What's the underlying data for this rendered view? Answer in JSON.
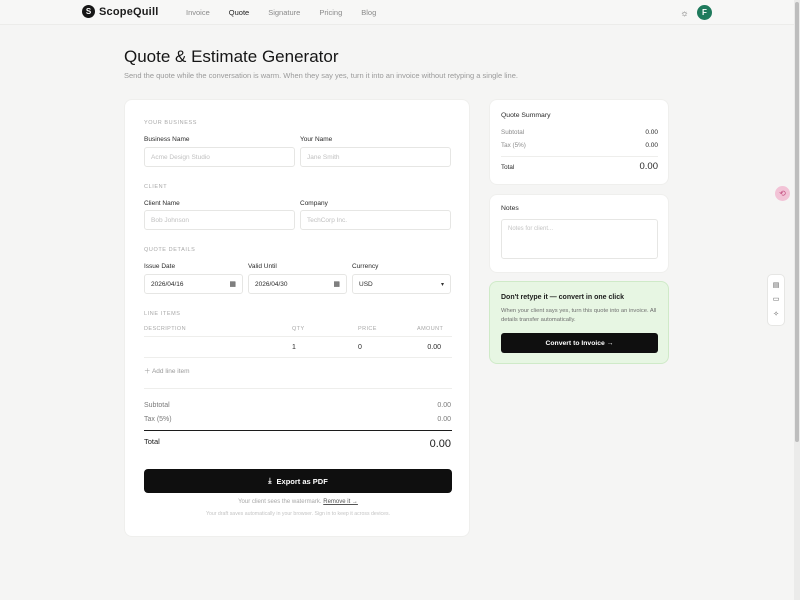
{
  "nav": {
    "brand": "ScopeQuill",
    "links": [
      "Invoice",
      "Quote",
      "Signature",
      "Pricing",
      "Blog"
    ],
    "active": "Quote",
    "avatar_initial": "F"
  },
  "header": {
    "title": "Quote & Estimate Generator",
    "subtitle": "Send the quote while the conversation is warm. When they say yes, turn it into an invoice without retyping a single line."
  },
  "form": {
    "your_business": {
      "section_label": "YOUR BUSINESS",
      "business_name_label": "Business Name",
      "business_name_placeholder": "Acme Design Studio",
      "your_name_label": "Your Name",
      "your_name_placeholder": "Jane Smith"
    },
    "client": {
      "section_label": "CLIENT",
      "client_name_label": "Client Name",
      "client_name_placeholder": "Bob Johnson",
      "company_label": "Company",
      "company_placeholder": "TechCorp Inc."
    },
    "quote_details": {
      "section_label": "QUOTE DETAILS",
      "issue_date_label": "Issue Date",
      "issue_date_value": "2026/04/16",
      "valid_until_label": "Valid Until",
      "valid_until_value": "2026/04/30",
      "currency_label": "Currency",
      "currency_value": "USD"
    },
    "line_items": {
      "section_label": "LINE ITEMS",
      "columns": [
        "DESCRIPTION",
        "QTY",
        "PRICE",
        "AMOUNT"
      ],
      "rows": [
        {
          "description": "",
          "qty": "1",
          "price": "0",
          "amount": "0.00"
        }
      ],
      "add_label": "Add line item"
    },
    "totals": {
      "subtotal_label": "Subtotal",
      "subtotal_value": "0.00",
      "tax_label": "Tax (5%)",
      "tax_value": "0.00",
      "total_label": "Total",
      "total_value": "0.00"
    },
    "export_label": "Export as PDF",
    "watermark_text": "Your client sees the watermark.",
    "watermark_link": "Remove it →",
    "draft_note": "Your draft saves automatically in your browser. Sign in to keep it across devices."
  },
  "summary": {
    "title": "Quote Summary",
    "subtotal_label": "Subtotal",
    "subtotal_value": "0.00",
    "tax_label": "Tax (5%)",
    "tax_value": "0.00",
    "total_label": "Total",
    "total_value": "0.00"
  },
  "notes": {
    "title": "Notes",
    "placeholder": "Notes for client..."
  },
  "convert": {
    "title": "Don't retype it — convert in one click",
    "description": "When your client says yes, turn this quote into an invoice. All details transfer automatically.",
    "button_label": "Convert to Invoice →"
  },
  "colors": {
    "accent": "#0f0f0f",
    "avatar": "#1f7a5c",
    "convert_bg": "#e7f6e3"
  },
  "icons": [
    "sun-icon",
    "calendar-icon",
    "chevron-down-icon",
    "plus-icon",
    "download-icon",
    "document-icon",
    "panel-icon",
    "sparkle-icon",
    "translate-icon"
  ]
}
